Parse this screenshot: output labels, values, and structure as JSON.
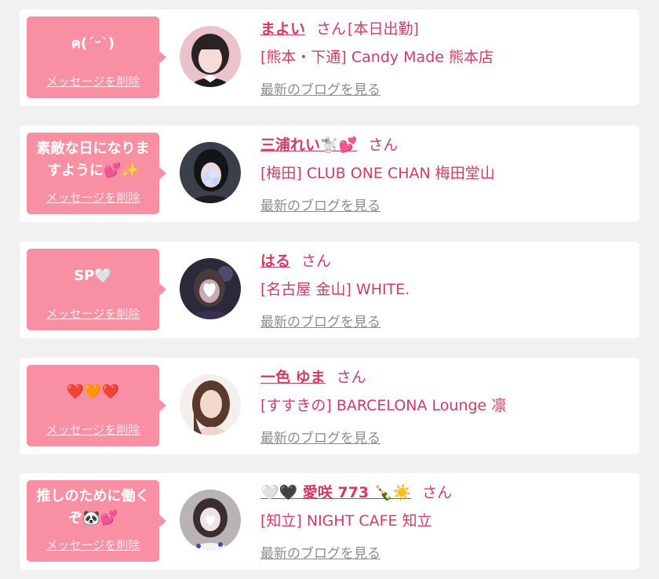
{
  "colors": {
    "accent": "#d53a62",
    "bubble": "#f98fa3",
    "background": "#f1f1f1",
    "card": "#ffffff",
    "link_gray": "#8c8c8c"
  },
  "items": [
    {
      "message": "ฅ(ˊᵕˋ)",
      "delete_label": "メッセージを削除",
      "name": "まよい",
      "honorific": "さん",
      "status": "[本日出勤]",
      "shop": "[熊本・下通] Candy Made 熊本店",
      "blog_link": "最新のブログを見る",
      "avatar": "cast-photo-1"
    },
    {
      "message": "素敵な日になりますように💕✨",
      "delete_label": "メッセージを削除",
      "name": "三浦れい🐩💕",
      "honorific": "さん",
      "status": "",
      "shop": "[梅田] CLUB ONE CHAN 梅田堂山",
      "blog_link": "最新のブログを見る",
      "avatar": "cast-photo-2"
    },
    {
      "message": "SP🤍",
      "delete_label": "メッセージを削除",
      "name": "はる",
      "honorific": "さん",
      "status": "",
      "shop": "[名古屋 金山] WHITE.",
      "blog_link": "最新のブログを見る",
      "avatar": "cast-photo-3"
    },
    {
      "message": "❤️🧡❤️",
      "delete_label": "メッセージを削除",
      "name": "一色 ゆま",
      "honorific": "さん",
      "status": "",
      "shop": "[すすきの] BARCELONA Lounge 凛",
      "blog_link": "最新のブログを見る",
      "avatar": "cast-photo-4"
    },
    {
      "message": "推しのために働くぞ🐼💕",
      "delete_label": "メッセージを削除",
      "name": "🤍🖤 愛咲 773 🍾☀️",
      "honorific": "さん",
      "status": "",
      "shop": "[知立] NIGHT CAFE 知立",
      "blog_link": "最新のブログを見る",
      "avatar": "cast-photo-5"
    }
  ]
}
